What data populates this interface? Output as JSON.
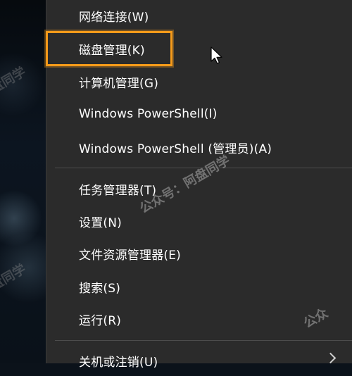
{
  "menu": {
    "items": [
      {
        "label": "网络连接(W)"
      },
      {
        "label": "磁盘管理(K)"
      },
      {
        "label": "计算机管理(G)"
      },
      {
        "label": "Windows PowerShell(I)"
      },
      {
        "label": "Windows PowerShell (管理员)(A)"
      },
      {
        "label": "任务管理器(T)"
      },
      {
        "label": "设置(N)"
      },
      {
        "label": "文件资源管理器(E)"
      },
      {
        "label": "搜索(S)"
      },
      {
        "label": "运行(R)"
      },
      {
        "label": "关机或注销(U)"
      }
    ],
    "highlighted_item": "磁盘管理(K)",
    "highlight_color": "#f49a1a",
    "background_color": "#2b2b2b"
  },
  "icons": {
    "submenu_arrow": "chevron-right-icon",
    "cursor": "mouse-pointer-icon"
  },
  "watermarks": [
    "盘同学",
    "盘同学",
    "公众号：阿盘同学",
    "公众"
  ]
}
